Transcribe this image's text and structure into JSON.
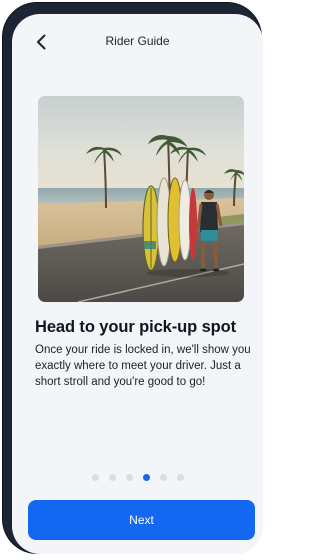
{
  "header": {
    "title": "Rider Guide",
    "back_icon": "chevron-left-icon"
  },
  "hero": {
    "description_icon": "beach-surfboards-illustration"
  },
  "content": {
    "heading": "Head to your pick-up spot",
    "body": "Once your ride is locked in, we'll show you exactly where to meet your driver. Just a short stroll and you're good to go!"
  },
  "pagination": {
    "total": 6,
    "active_index": 3
  },
  "actions": {
    "next_label": "Next"
  },
  "colors": {
    "accent": "#1467f0",
    "background": "#f4f5f8",
    "frame": "#1d2433",
    "dot_inactive": "#d9dde6"
  }
}
